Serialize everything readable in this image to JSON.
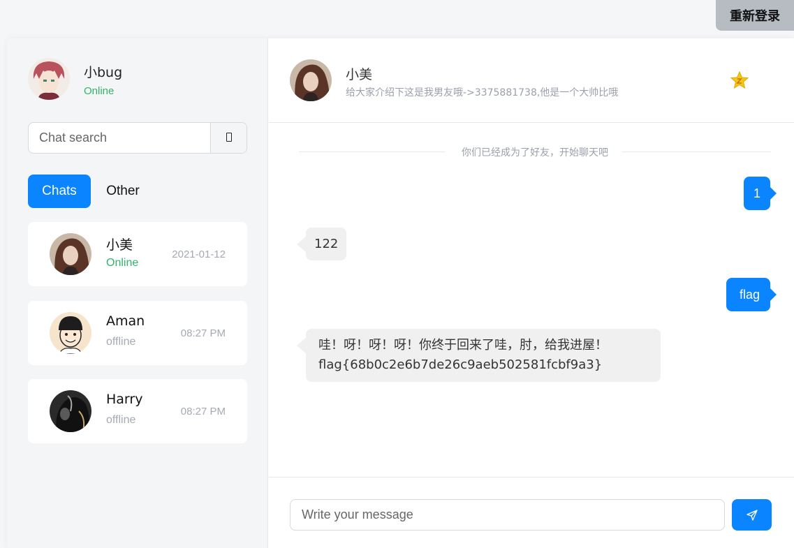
{
  "top_bar": {
    "relogin_label": "重新登录"
  },
  "me": {
    "name": "小bug",
    "status": "Online"
  },
  "search": {
    "placeholder": "Chat search"
  },
  "tabs": [
    {
      "label": "Chats",
      "active": true
    },
    {
      "label": "Other",
      "active": false
    }
  ],
  "chats": [
    {
      "name": "小美",
      "status": "Online",
      "time": "2021-01-12"
    },
    {
      "name": "Aman",
      "status": "offline",
      "time": "08:27 PM"
    },
    {
      "name": "Harry",
      "status": "offline",
      "time": "08:27 PM"
    }
  ],
  "conversation": {
    "name": "小美",
    "signature": "给大家介绍下这是我男友哦->3375881738,他是一个大帅比哦",
    "system_notice": "你们已经成为了好友，开始聊天吧",
    "messages": [
      {
        "direction": "out",
        "text": "1"
      },
      {
        "direction": "in",
        "text": "122"
      },
      {
        "direction": "out",
        "text": "flag"
      },
      {
        "direction": "in",
        "lines": [
          "哇！呀！呀！呀！你终于回来了哇，肘，给我进屋！",
          "flag{68b0c2e6b7de26c9aeb502581fcbf9a3}"
        ]
      }
    ]
  },
  "composer": {
    "placeholder": "Write your message"
  },
  "colors": {
    "accent": "#0a84ff",
    "online": "#2fb46a",
    "muted": "#a5a9b6",
    "star": "#f5c518"
  }
}
